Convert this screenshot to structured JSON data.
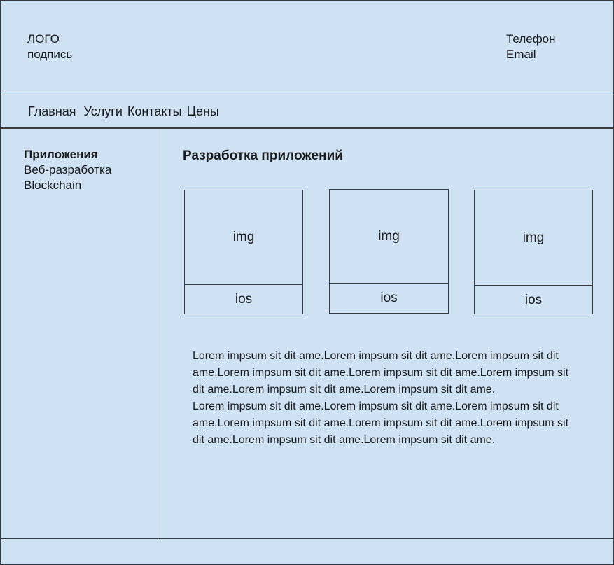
{
  "header": {
    "logo": "ЛОГО",
    "tagline": "подпись",
    "phone": "Телефон",
    "email": "Email"
  },
  "nav": {
    "items": [
      "Главная",
      "Услуги",
      "Контакты",
      "Цены"
    ]
  },
  "sidebar": {
    "items": [
      {
        "label": "Приложения",
        "active": true
      },
      {
        "label": "Веб-разработка",
        "active": false
      },
      {
        "label": "Blockchain",
        "active": false
      }
    ]
  },
  "main": {
    "title": "Разработка приложений",
    "cards": [
      {
        "image_label": "img",
        "caption": "ios"
      },
      {
        "image_label": "img",
        "caption": "ios"
      },
      {
        "image_label": "img",
        "caption": "ios"
      }
    ],
    "paragraphs": [
      "Lorem impsum sit dit ame.Lorem impsum sit dit ame.Lorem impsum sit dit ame.Lorem impsum sit dit ame.Lorem impsum sit dit ame.Lorem impsum sit dit ame.Lorem impsum sit dit ame.Lorem impsum sit dit ame.",
      "Lorem impsum sit dit ame.Lorem impsum sit dit ame.Lorem impsum sit dit ame.Lorem impsum sit dit ame.Lorem impsum sit dit ame.Lorem impsum sit dit ame.Lorem impsum sit dit ame.Lorem impsum sit dit ame."
    ]
  },
  "colors": {
    "background": "#cfe2f3",
    "border": "#3c3c3c",
    "text": "#1a1a1a"
  }
}
